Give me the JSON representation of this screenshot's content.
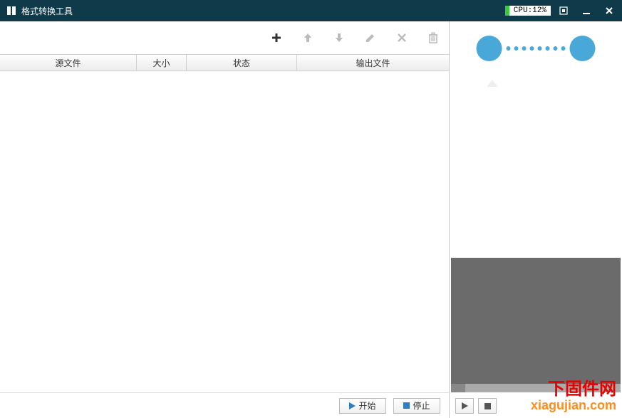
{
  "titlebar": {
    "title": "格式转换工具",
    "cpu_label": "CPU:12%"
  },
  "toolbar": {
    "icons": {
      "add": "add-icon",
      "up": "arrow-up-icon",
      "down": "arrow-down-icon",
      "edit": "pencil-icon",
      "remove": "x-icon",
      "clear": "trash-icon"
    }
  },
  "table": {
    "headers": {
      "source": "源文件",
      "size": "大小",
      "status": "状态",
      "output": "输出文件"
    },
    "rows": []
  },
  "actions": {
    "start": "开始",
    "stop": "停止"
  },
  "watermark": {
    "cn": "下固件网",
    "url": "xiagujian.com"
  }
}
